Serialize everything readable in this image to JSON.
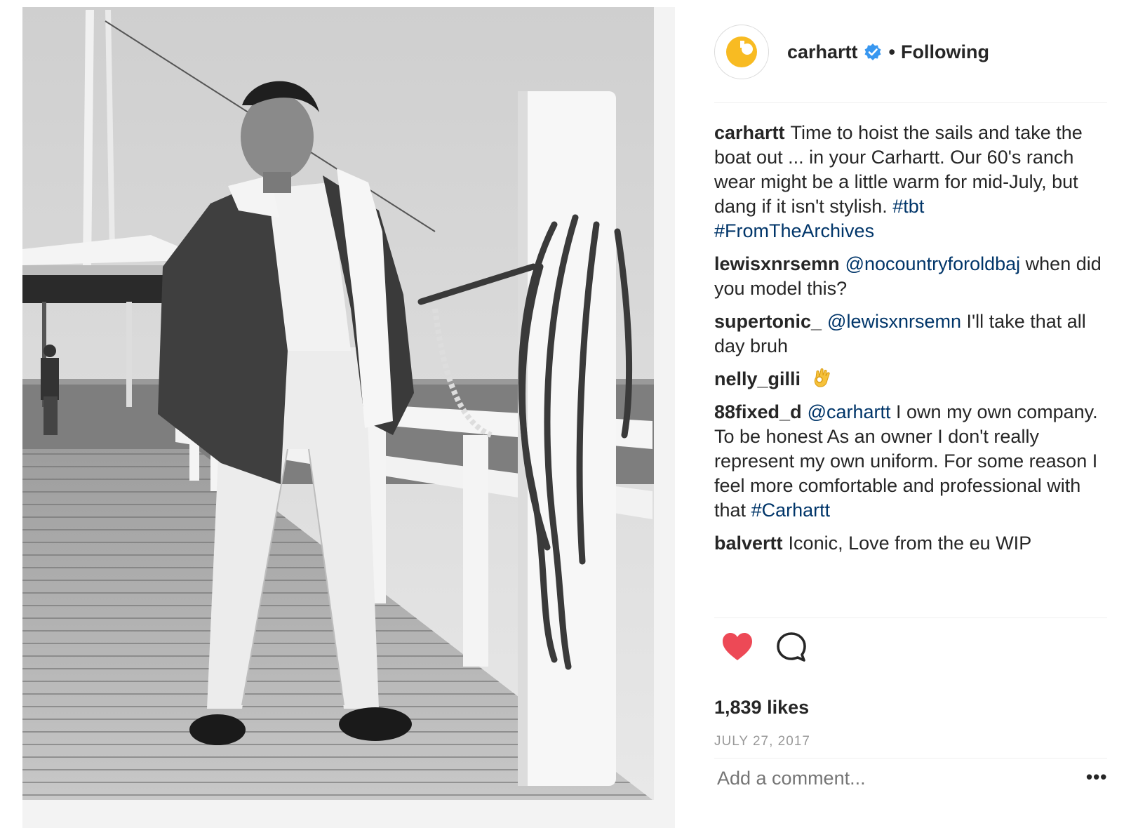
{
  "post": {
    "photo_alt": "Black and white photo of a man in a jacket on a pier"
  },
  "header": {
    "username": "carhartt",
    "separator": "•",
    "follow_status": "Following"
  },
  "caption": {
    "username": "carhartt",
    "text": "Time to hoist the sails and take the boat out ... in your Carhartt. Our 60's ranch wear might be a little warm for mid-July, but dang if it isn't stylish.",
    "hashtag_1": "#tbt",
    "hashtag_2": "#FromTheArchives"
  },
  "comments": [
    {
      "username": "lewisxnrsemn",
      "mention": "@nocountryforoldbaj",
      "text": "when did you model this?"
    },
    {
      "username": "supertonic_",
      "mention": "@lewisxnrsemn",
      "text": "I'll take that all day bruh"
    },
    {
      "username": "nelly_gilli",
      "emoji": "ok-hand-emoji"
    },
    {
      "username": "88fixed_d",
      "mention": "@carhartt",
      "text": "I own my own company. To be honest As an owner I don't really represent my own uniform. For some reason I feel more comfortable and professional with that",
      "hashtag": "#Carhartt"
    },
    {
      "username": "balvertt",
      "text": "Iconic, Love from the eu WIP"
    }
  ],
  "actions": {
    "like_icon": "heart-icon",
    "comment_icon": "comment-bubble-icon",
    "like_color": "#ed4956"
  },
  "likes_text": "1,839 likes",
  "date": "JULY 27, 2017",
  "comment_box": {
    "placeholder": "Add a comment...",
    "more_label": "•••"
  },
  "colors": {
    "link": "#003569",
    "verified": "#3897f0",
    "avatar_brand": "#f8bb22"
  }
}
